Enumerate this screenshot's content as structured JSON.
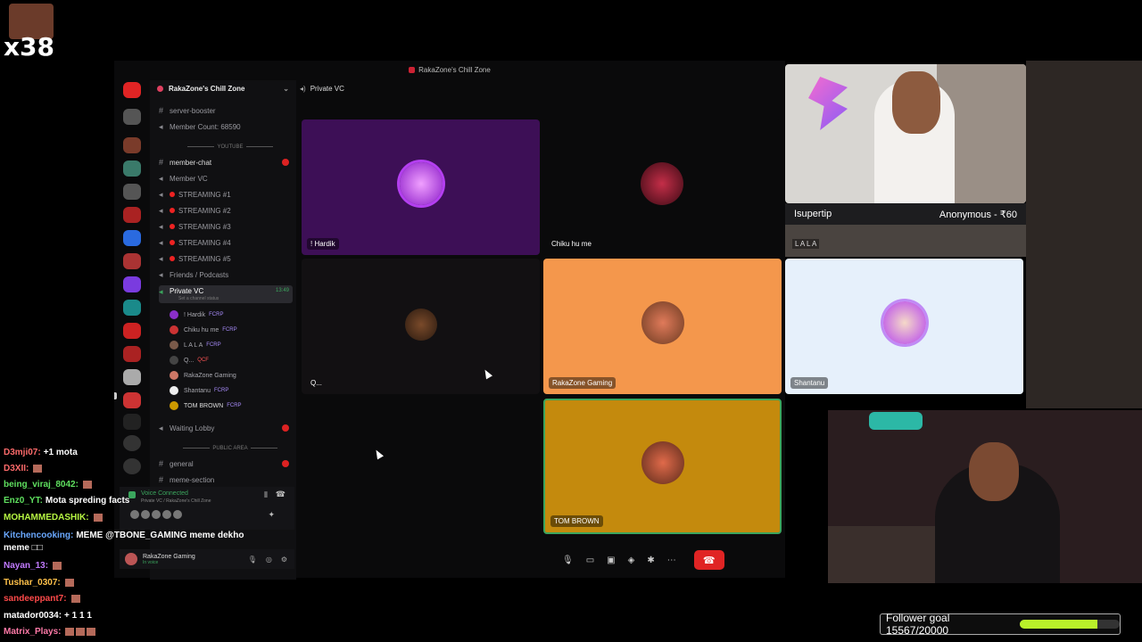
{
  "overlay": {
    "combo_count": "x38"
  },
  "window": {
    "title": "RakaZone's Chill Zone"
  },
  "server": {
    "name": "RakaZone's Chill Zone",
    "channels": [
      {
        "label": "server-booster",
        "type": "text"
      },
      {
        "label": "Member Count: 68590",
        "type": "text"
      },
      {
        "label": "member-chat",
        "type": "text"
      },
      {
        "label": "Member VC",
        "type": "voice"
      },
      {
        "label": "STREAMING #1",
        "type": "voice"
      },
      {
        "label": "STREAMING #2",
        "type": "voice"
      },
      {
        "label": "STREAMING #3",
        "type": "voice"
      },
      {
        "label": "STREAMING #4",
        "type": "voice"
      },
      {
        "label": "STREAMING #5",
        "type": "voice"
      },
      {
        "label": "Friends / Podcasts",
        "type": "voice"
      },
      {
        "label": "Private VC",
        "type": "voice"
      },
      {
        "label": "Waiting Lobby",
        "type": "voice"
      },
      {
        "label": "general",
        "type": "text"
      },
      {
        "label": "meme-section",
        "type": "text"
      }
    ],
    "sections": {
      "youtube": "YOUTUBE",
      "public": "PUBLIC AREA"
    },
    "private_vc_time": "13:49",
    "private_vc_status": "Set a channel status",
    "members": [
      {
        "name": "! Hardik",
        "tag": "FCRP"
      },
      {
        "name": "Chiku hu me",
        "tag": "FCRP"
      },
      {
        "name": "L A L A",
        "tag": "FCRP"
      },
      {
        "name": "Q...",
        "tag": "QCF"
      },
      {
        "name": "RakaZone Gaming",
        "tag": ""
      },
      {
        "name": "Shantanu",
        "tag": "FCRP"
      },
      {
        "name": "TOM BROWN",
        "tag": "FCRP"
      }
    ]
  },
  "voice_panel": {
    "status": "Voice Connected",
    "channel": "Private VC / RakaZone's Chill Zone"
  },
  "user_bar": {
    "name": "RakaZone Gaming",
    "status": "In voice"
  },
  "vc_header": {
    "title": "Private VC"
  },
  "tiles": [
    {
      "name": "! Hardik"
    },
    {
      "name": "Chiku hu me"
    },
    {
      "name": "L A L A"
    },
    {
      "name": "Q..."
    },
    {
      "name": "RakaZone Gaming"
    },
    {
      "name": "Shantanu"
    },
    {
      "name": "TOM BROWN"
    }
  ],
  "donation": {
    "left": "Isupertip",
    "right": "Anonymous - ₹60"
  },
  "chat": [
    {
      "user": "D3mji07:",
      "text": "+1 mota"
    },
    {
      "user": "D3XII:",
      "text": ""
    },
    {
      "user": "being_viraj_8042:",
      "text": ""
    },
    {
      "user": "Enz0_YT:",
      "text": "Mota spreding facts"
    },
    {
      "user": "MOHAMMEDASHIK:",
      "text": ""
    },
    {
      "user": "Kitchencooking:",
      "text": "MEME @TBONE_GAMING meme dekho"
    },
    {
      "user": "",
      "text": "meme □□"
    },
    {
      "user": "Nayan_13:",
      "text": ""
    },
    {
      "user": "Tushar_0307:",
      "text": ""
    },
    {
      "user": "sandeeppant7:",
      "text": ""
    },
    {
      "user": "matador0034:",
      "text": "+ 1 1 1"
    },
    {
      "user": "Matrix_Plays:",
      "text": ""
    }
  ],
  "follower_goal": {
    "label": "Follower goal 15567/20000",
    "progress": 0.7784
  }
}
